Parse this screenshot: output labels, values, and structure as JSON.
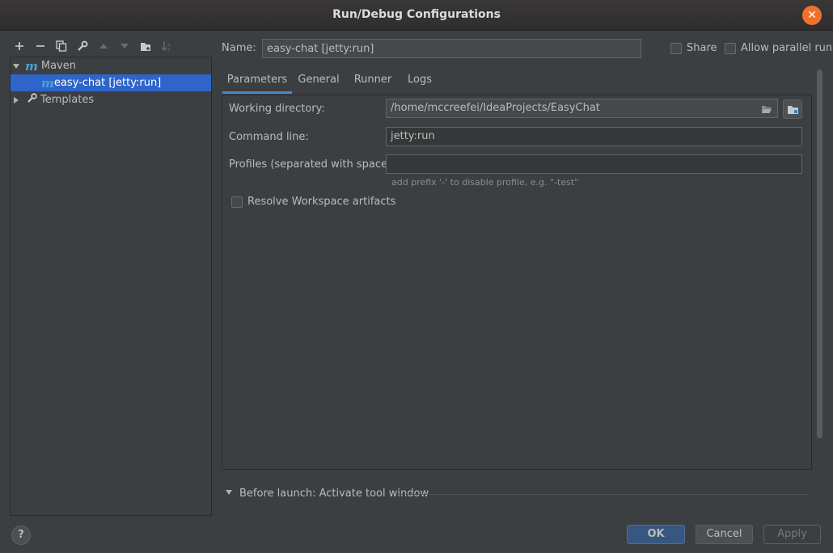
{
  "window": {
    "title": "Run/Debug Configurations",
    "close_glyph": "✕"
  },
  "toolbar": {
    "icons": [
      "add-icon",
      "remove-icon",
      "copy-icon",
      "wrench-icon",
      "move-up-icon",
      "move-down-icon",
      "new-folder-icon",
      "sort-icon"
    ]
  },
  "tree": {
    "maven_label": "Maven",
    "maven_glyph": "m",
    "config_label": "easy-chat [jetty:run]",
    "templates_label": "Templates"
  },
  "header": {
    "name_label": "Name:",
    "name_value": "easy-chat [jetty:run]",
    "share_label": "Share",
    "parallel_label": "Allow parallel run"
  },
  "tabs": [
    "Parameters",
    "General",
    "Runner",
    "Logs"
  ],
  "params": {
    "working_dir_label": "Working directory:",
    "working_dir_value": "/home/mccreefei/IdeaProjects/EasyChat",
    "command_line_label": "Command line:",
    "command_line_value": "jetty:run",
    "profiles_label": "Profiles (separated with space):",
    "profiles_value": "",
    "profiles_hint": "add prefix '-' to disable profile, e.g. \"-test\"",
    "resolve_label": "Resolve Workspace artifacts"
  },
  "before_launch": {
    "label": "Before launch: Activate tool window"
  },
  "buttons": {
    "help": "?",
    "ok": "OK",
    "cancel": "Cancel",
    "apply": "Apply"
  },
  "colors": {
    "accent": "#2f65ca",
    "close": "#f0712e",
    "ok": "#365880",
    "tab_underline": "#4a88c7"
  }
}
